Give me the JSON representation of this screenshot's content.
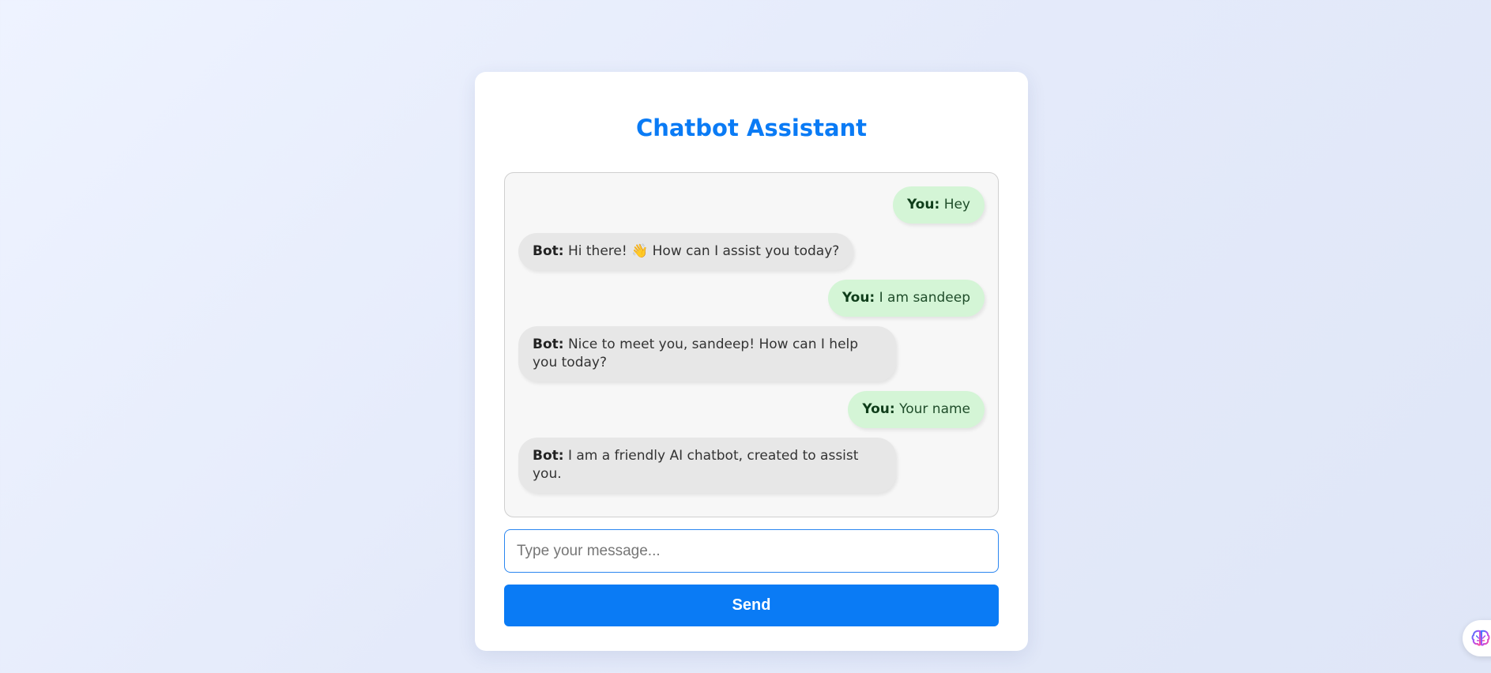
{
  "app": {
    "title": "Chatbot Assistant"
  },
  "messages": [
    {
      "role": "user",
      "speaker": "You:",
      "text": "Hey"
    },
    {
      "role": "bot",
      "speaker": "Bot:",
      "text": "Hi there! 👋 How can I assist you today?"
    },
    {
      "role": "user",
      "speaker": "You:",
      "text": "I am sandeep"
    },
    {
      "role": "bot",
      "speaker": "Bot:",
      "text": "Nice to meet you, sandeep! How can I help you today?"
    },
    {
      "role": "user",
      "speaker": "You:",
      "text": "Your name"
    },
    {
      "role": "bot",
      "speaker": "Bot:",
      "text": "I am a friendly AI chatbot, created to assist you."
    }
  ],
  "composer": {
    "placeholder": "Type your message...",
    "value": "",
    "send_label": "Send"
  },
  "widget": {
    "icon": "brain-icon"
  },
  "colors": {
    "accent": "#0a7bf5",
    "user_bubble": "#d4f5d6",
    "bot_bubble": "#e7e7e7"
  }
}
